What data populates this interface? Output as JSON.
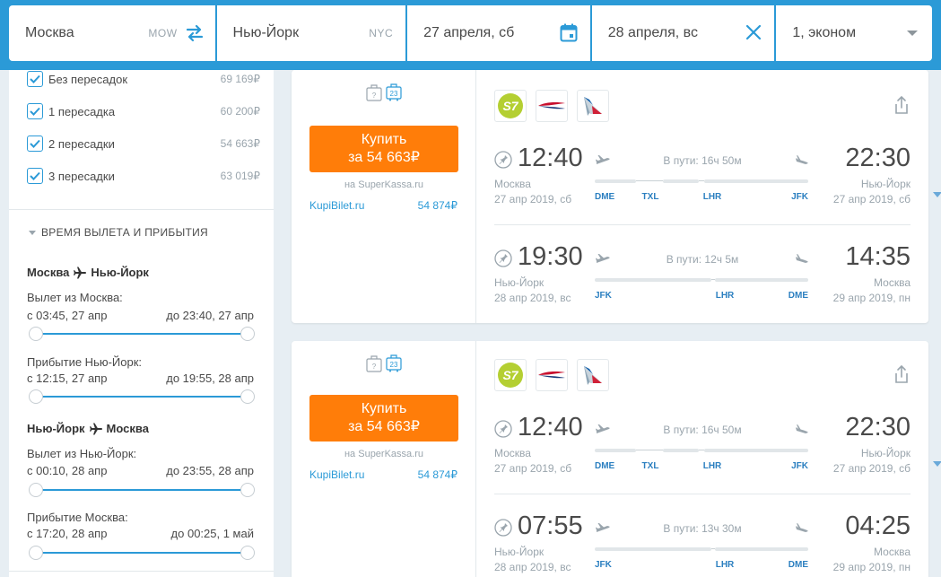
{
  "search": {
    "origin": "Москва",
    "origin_code": "MOW",
    "destination": "Нью-Йорк",
    "destination_code": "NYC",
    "depart_date": "27 апреля, сб",
    "return_date": "28 апреля, вс",
    "passengers": "1, эконом"
  },
  "filters": {
    "stops": [
      {
        "label": "Без пересадок",
        "price": "69 169₽",
        "checked": true
      },
      {
        "label": "1 пересадка",
        "price": "60 200₽",
        "checked": true
      },
      {
        "label": "2 пересадки",
        "price": "54 663₽",
        "checked": true
      },
      {
        "label": "3 пересадки",
        "price": "63 019₽",
        "checked": true
      }
    ],
    "time_section_title": "ВРЕМЯ ВЫЛЕТА И ПРИБЫТИЯ",
    "outbound": {
      "route_from": "Москва",
      "route_to": "Нью-Йорк",
      "departure_label": "Вылет из Москва:",
      "departure_from": "с 03:45, 27 апр",
      "departure_to": "до 23:40, 27 апр",
      "arrival_label": "Прибытие Нью-Йорк:",
      "arrival_from": "с 12:15, 27 апр",
      "arrival_to": "до 19:55, 28 апр"
    },
    "inbound": {
      "route_from": "Нью-Йорк",
      "route_to": "Москва",
      "departure_label": "Вылет из Нью-Йорк:",
      "departure_from": "с 00:10, 28 апр",
      "departure_to": "до 23:55, 28 апр",
      "arrival_label": "Прибытие Москва:",
      "arrival_from": "с 17:20, 28 апр",
      "arrival_to": "до 00:25, 1 май"
    }
  },
  "tickets": [
    {
      "buy_label": "Купить",
      "buy_price": "за 54 663₽",
      "via": "на SuperKassa.ru",
      "alt_agent": "KupiBilet.ru",
      "alt_price": "54 874₽",
      "baggage_unknown": "?",
      "baggage_weight": "23",
      "segments": [
        {
          "dep_time": "12:40",
          "dep_city": "Москва",
          "dep_date": "27 апр 2019, сб",
          "duration": "В пути: 16ч 50м",
          "arr_time": "22:30",
          "arr_city": "Нью-Йорк",
          "arr_date": "27 апр 2019, сб",
          "airports": [
            "DME",
            "TXL",
            "LHR",
            "JFK"
          ]
        },
        {
          "dep_time": "19:30",
          "dep_city": "Нью-Йорк",
          "dep_date": "28 апр 2019, вс",
          "duration": "В пути: 12ч 5м",
          "arr_time": "14:35",
          "arr_city": "Москва",
          "arr_date": "29 апр 2019, пн",
          "airports": [
            "JFK",
            "LHR",
            "DME"
          ]
        }
      ]
    },
    {
      "buy_label": "Купить",
      "buy_price": "за 54 663₽",
      "via": "на SuperKassa.ru",
      "alt_agent": "KupiBilet.ru",
      "alt_price": "54 874₽",
      "baggage_unknown": "?",
      "baggage_weight": "23",
      "segments": [
        {
          "dep_time": "12:40",
          "dep_city": "Москва",
          "dep_date": "27 апр 2019, сб",
          "duration": "В пути: 16ч 50м",
          "arr_time": "22:30",
          "arr_city": "Нью-Йорк",
          "arr_date": "27 апр 2019, сб",
          "airports": [
            "DME",
            "TXL",
            "LHR",
            "JFK"
          ]
        },
        {
          "dep_time": "07:55",
          "dep_city": "Нью-Йорк",
          "dep_date": "28 апр 2019, вс",
          "duration": "В пути: 13ч 30м",
          "arr_time": "04:25",
          "arr_city": "Москва",
          "arr_date": "29 апр 2019, пн",
          "airports": [
            "JFK",
            "LHR",
            "DME"
          ]
        }
      ]
    }
  ],
  "airline_logos": [
    "s7-logo",
    "british-airways-logo",
    "american-airlines-logo"
  ],
  "colors": {
    "accent": "#2b9ad7",
    "buy": "#ff7d09",
    "s7": "#b4cf32"
  }
}
